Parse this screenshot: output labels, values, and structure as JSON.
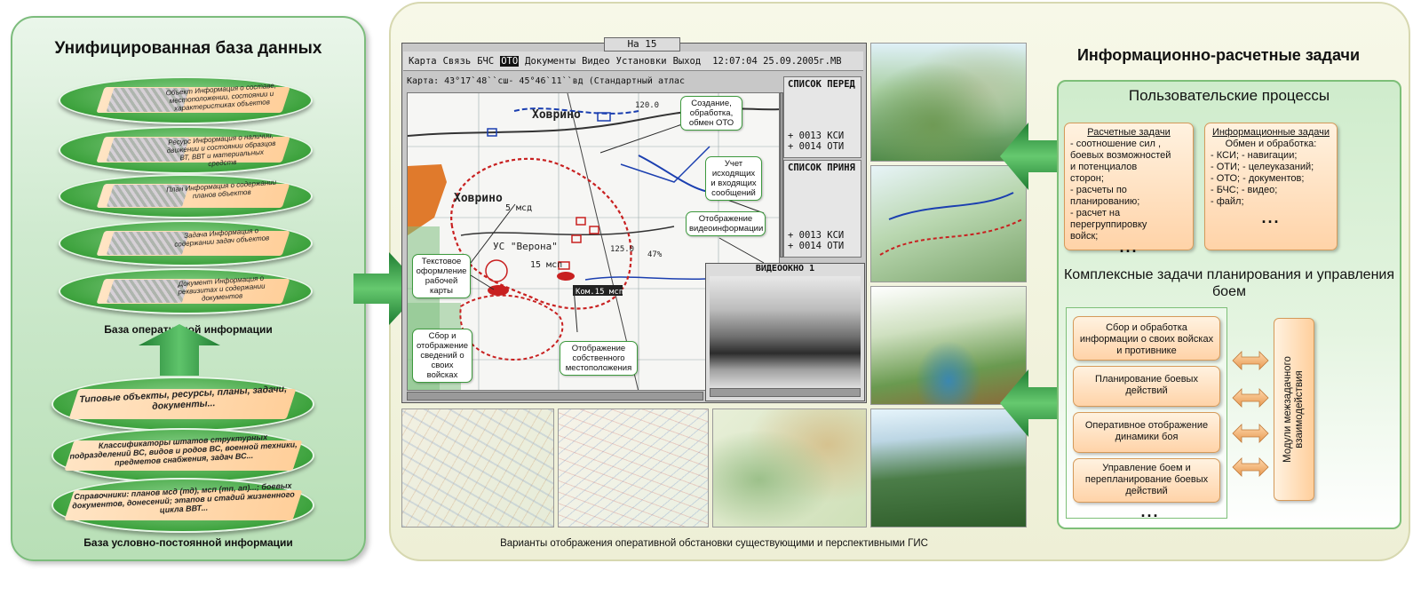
{
  "left": {
    "title": "Унифицированная база данных",
    "discs": [
      {
        "text": "Объект Информация о составе, местоположении, состоянии и характеристиках объектов"
      },
      {
        "text": "Ресурс Информация о наличии, движении и состоянии образцов ВТ, ВВТ и материальных средств"
      },
      {
        "text": "План Информация о содержании планов объектов"
      },
      {
        "text": "Задача Информация о содержании задач объектов"
      },
      {
        "text": "Документ Информация о реквизитах и содержании документов"
      }
    ],
    "operational_caption": "База оперативной информации",
    "ref_discs": [
      {
        "text": "Типовые объекты, ресурсы, планы, задачи, документы..."
      },
      {
        "text": "Классификаторы штатов структурных подразделений ВС, видов и родов ВС, военной техники, предметов снабжения, задач ВС..."
      },
      {
        "text": "Справочники: планов мсд (тд), мсп (тп, ап)...; боевых документов, донесений; этапов и стадий жизненного цикла ВВТ..."
      }
    ],
    "permanent_caption": "База условно-постоянной информации"
  },
  "map_window": {
    "tab_title": "На 15",
    "menu": [
      "Карта",
      "Связь",
      "БЧС",
      "ОТО",
      "Документы",
      "Видео",
      "Установки",
      "Выход"
    ],
    "menu_selected": "ОТО",
    "clock": "12:07:04 25.09.2005г.МВ",
    "coords": "Карта:  43°17`48``сш- 45°46`11``вд (Стандартный атлас",
    "list_out": {
      "header": "СПИСОК ПЕРЕД",
      "rows": [
        "+ 0013 КСИ",
        "+ 0014 ОТИ"
      ]
    },
    "list_in": {
      "header": "СПИСОК ПРИНЯ",
      "rows": [
        "+ 0013 КСИ",
        "+ 0014 ОТИ"
      ]
    },
    "video_title": "ВИДЕООКНО 1",
    "map_labels": {
      "town1": "Ховрино",
      "town2": "Ховрино",
      "us": "УС \"Верона\"",
      "unit1": "5 мсд",
      "unit2": "15 мсп",
      "commander": "Ком.15 мсп",
      "hill1": "120.0",
      "hill2": "125.0",
      "pct": "47%"
    }
  },
  "callouts": {
    "create": "Создание, обработка, обмен ОТО",
    "account": "Учет исходящих и входящих сообщений",
    "video": "Отображение видеоинформации",
    "text_design": "Текстовое оформление рабочей карты",
    "own_troops": "Сбор и отображение сведений о своих войсках",
    "own_location": "Отображение собственного местоположения"
  },
  "bottom_caption": "Варианты отображения оперативной обстановки существующими и перспективными ГИС",
  "right": {
    "title": "Информационно-расчетные задачи",
    "user_processes": "Пользовательские процессы",
    "calc_tasks": {
      "title": "Расчетные задачи",
      "lines": [
        "- соотношение сил ,",
        "боевых возможностей",
        "и потенциалов",
        "сторон;",
        "- расчеты по",
        "планированию;",
        "- расчет на",
        "перегруппировку",
        "войск;"
      ],
      "dots": "..."
    },
    "info_tasks": {
      "title": "Информационные задачи",
      "sub": "Обмен и обработка:",
      "lines": [
        "- КСИ;  - навигации;",
        "- ОТИ;  - целеуказаний;",
        "- ОТО;  - документов;",
        "- БЧС;    - видео;",
        "- файл;"
      ],
      "dots": "..."
    },
    "complex_title": "Комплексные задачи планирования и управления боем",
    "complex_tasks": [
      "Сбор и обработка информации о своих войсках и противнике",
      "Планирование боевых действий",
      "Оперативное отображение динамики боя",
      "Управление боем и перепланирование боевых действий"
    ],
    "complex_dots": "...",
    "modules": "Модули межзадачного взаимодействия"
  },
  "colors": {
    "green_accent": "#2e9b45",
    "orange_box": "#ffd3a8",
    "panel_beige": "#eeefd6"
  }
}
